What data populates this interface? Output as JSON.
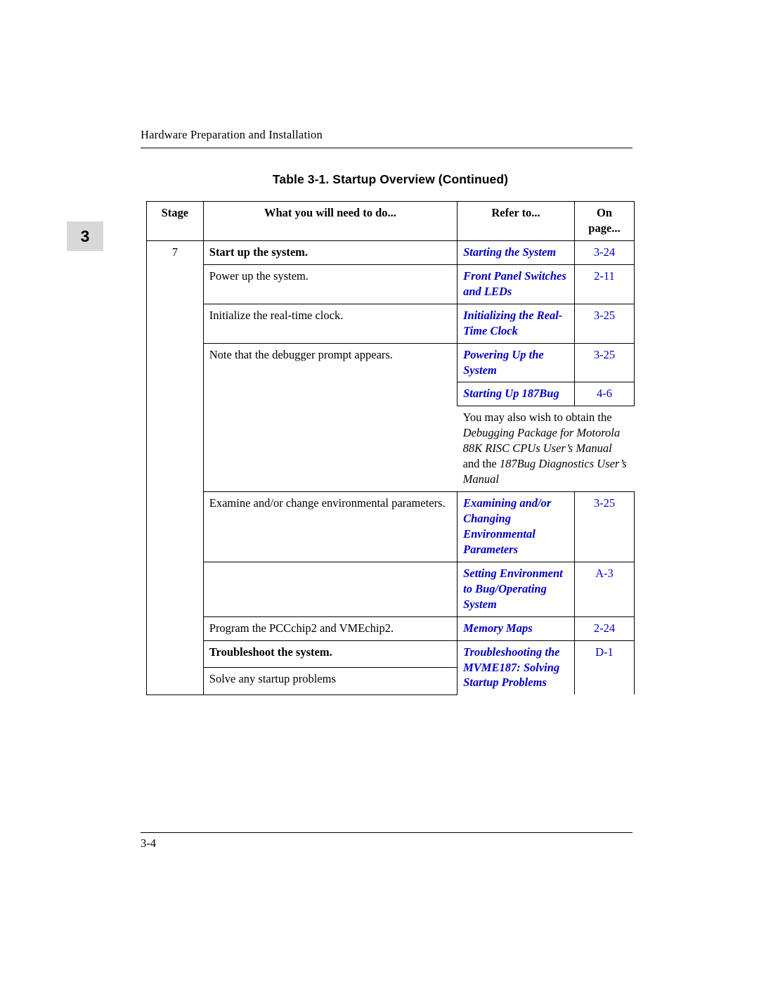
{
  "header": {
    "running_head": "Hardware Preparation and Installation"
  },
  "chapter_tab": "3",
  "table": {
    "caption": "Table 3-1. Startup Overview (Continued)",
    "columns": [
      "Stage",
      "What you will need to do...",
      "Refer to...",
      "On page..."
    ],
    "column_head_page_line1": "On",
    "column_head_page_line2": "page...",
    "rows": [
      {
        "stage": "7",
        "what": "Start up the system.",
        "what_bold": true,
        "refer": "Starting the System",
        "page": "3-24"
      },
      {
        "stage": "",
        "what": "Power up the system.",
        "what_bold": false,
        "refer": "Front Panel Switches and LEDs",
        "page": "2-11"
      },
      {
        "stage": "",
        "what": "Initialize the real-time clock.",
        "what_bold": false,
        "refer": "Initializing the Real-Time Clock",
        "page": "3-25"
      },
      {
        "stage": "",
        "what": "Note that the debugger prompt appears.",
        "what_bold": false,
        "refer": "Powering Up the System",
        "page": "3-25"
      },
      {
        "stage": "",
        "what": "",
        "what_bold": false,
        "refer": "Starting Up 187Bug",
        "page": "4-6"
      },
      {
        "stage": "",
        "what_rich": [
          {
            "text": "You may also wish to obtain the ",
            "style": "normal"
          },
          {
            "text": "Debugging Package for Motorola 88K RISC CPUs User’s Manual",
            "style": "italic"
          },
          {
            "text": " and the ",
            "style": "normal"
          },
          {
            "text": "187Bug Diagnostics User’s Manual",
            "style": "italic"
          }
        ],
        "refer": "",
        "page": ""
      },
      {
        "stage": "",
        "what": "Examine and/or change environmental parameters.",
        "what_bold": false,
        "refer": "Examining and/or Changing Environmental Parameters",
        "page": "3-25"
      },
      {
        "stage": "",
        "what": "",
        "what_bold": false,
        "refer": "Setting Environment to Bug/Operating System",
        "page": "A-3"
      },
      {
        "stage": "",
        "what": "Program the PCCchip2 and VMEchip2.",
        "what_bold": false,
        "refer": "Memory Maps",
        "page": "2-24"
      },
      {
        "stage": "",
        "what": "Troubleshoot the system.",
        "what_bold": true,
        "refer": "Troubleshooting the MVME187: Solving Startup Problems",
        "page": "D-1"
      },
      {
        "stage": "",
        "what": "Solve any startup problems",
        "what_bold": false,
        "refer": "",
        "page": ""
      }
    ]
  },
  "footer": {
    "page_number": "3-4"
  },
  "colors": {
    "link": "#0000c8",
    "tab_background": "#d8d8d8",
    "rule": "#000000"
  }
}
